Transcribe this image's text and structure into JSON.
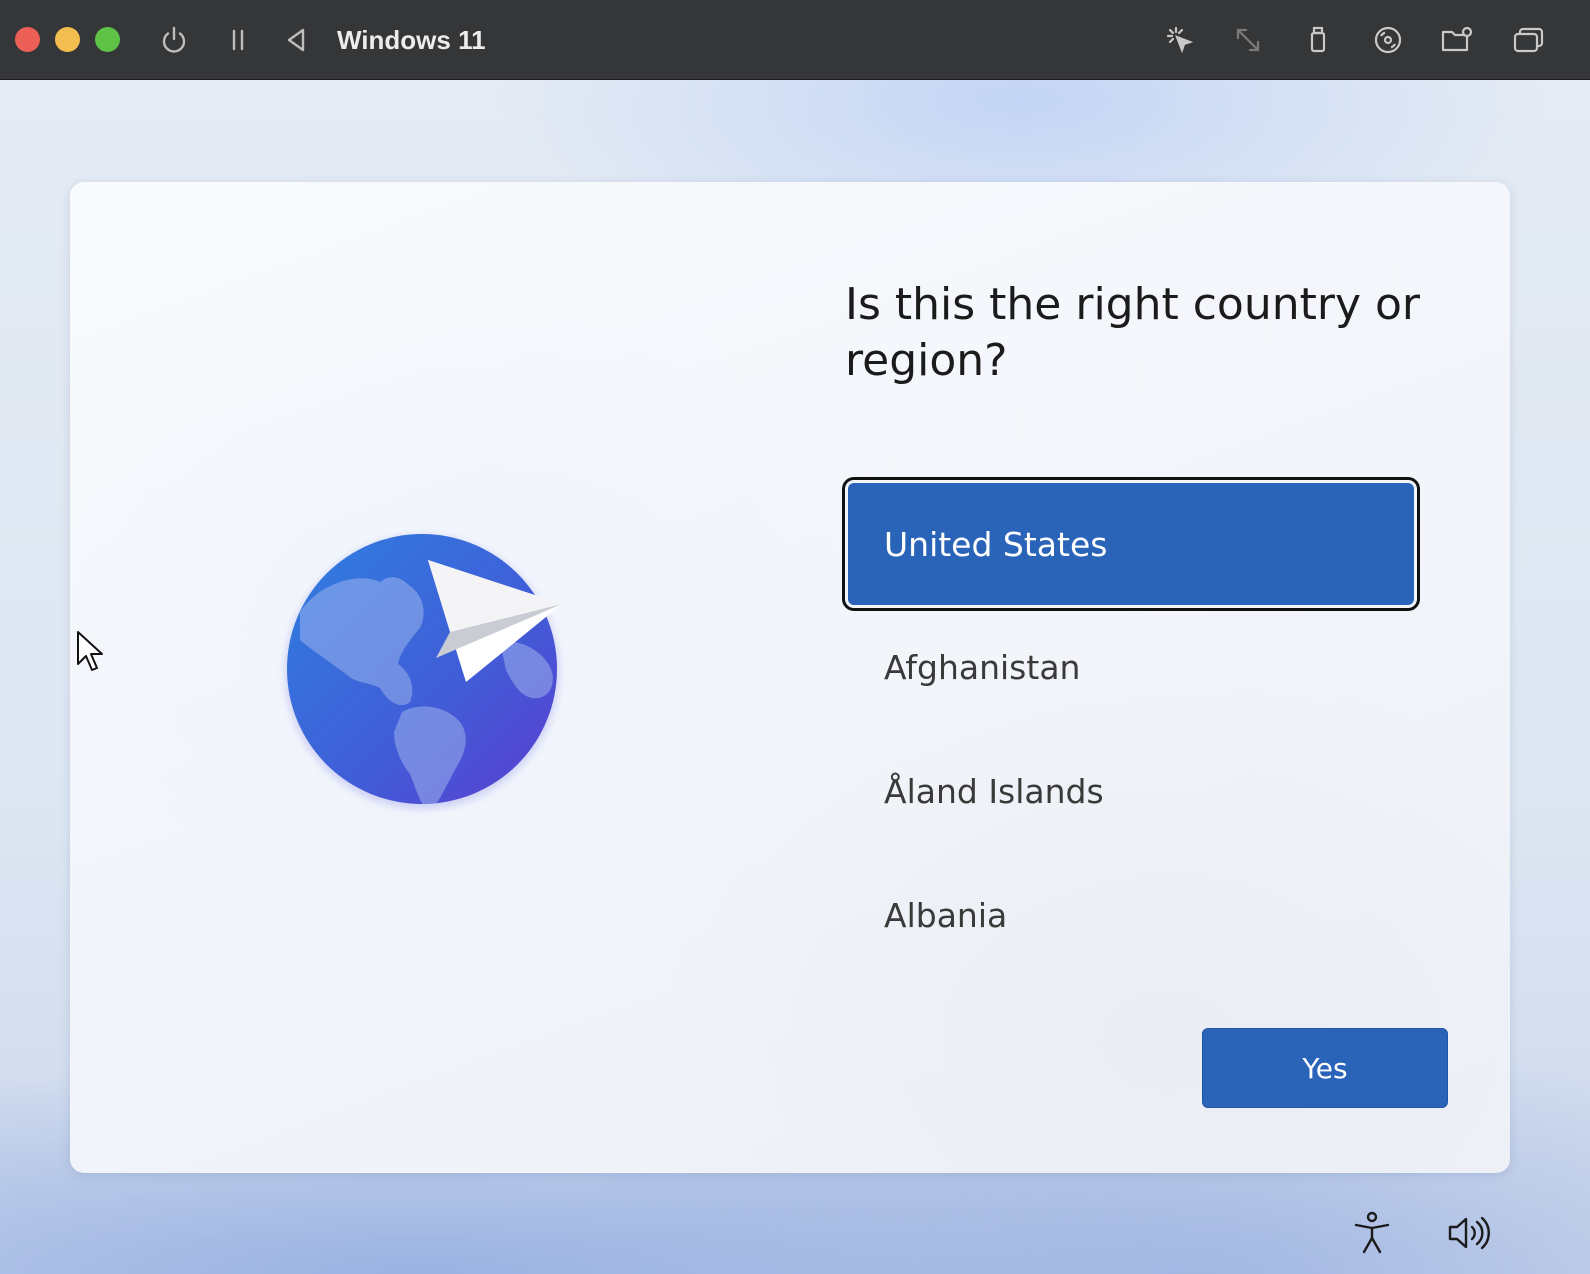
{
  "window": {
    "title": "Windows 11",
    "traffic_lights": {
      "close_color": "#ec5f57",
      "minimize_color": "#f4bd4f",
      "zoom_color": "#5ec246"
    },
    "toolbar_left_icons": [
      "power-icon",
      "pause-icon",
      "back-icon"
    ],
    "toolbar_right_icons": [
      "capture-mouse-icon",
      "resize-icon",
      "usb-icon",
      "disc-icon",
      "shared-folder-icon",
      "windows-icon"
    ]
  },
  "oobe": {
    "question": "Is this the right country or region?",
    "countries": [
      {
        "label": "United States",
        "selected": true
      },
      {
        "label": "Afghanistan",
        "selected": false
      },
      {
        "label": "Åland Islands",
        "selected": false
      },
      {
        "label": "Albania",
        "selected": false
      }
    ],
    "yes_label": "Yes",
    "accent_color": "#2a64b8"
  },
  "taskbar_icons": [
    "accessibility-icon",
    "volume-icon"
  ]
}
